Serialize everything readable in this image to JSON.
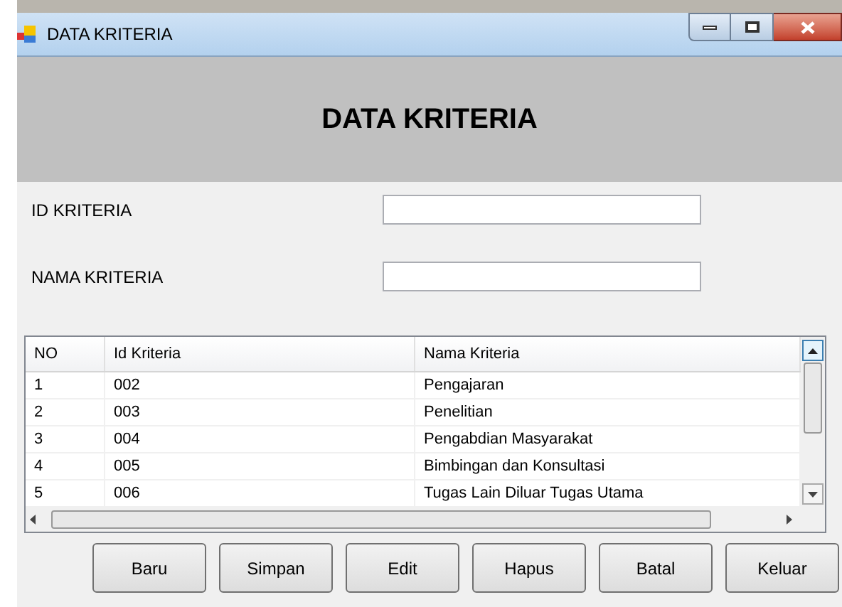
{
  "window": {
    "title": "DATA KRITERIA"
  },
  "header": {
    "title": "DATA KRITERIA"
  },
  "fields": [
    {
      "label": "ID KRITERIA"
    },
    {
      "label": "NAMA KRITERIA"
    }
  ],
  "table": {
    "columns": [
      "NO",
      "Id Kriteria",
      "Nama Kriteria"
    ],
    "rows": [
      [
        "1",
        "002",
        "Pengajaran"
      ],
      [
        "2",
        "003",
        "Penelitian"
      ],
      [
        "3",
        "004",
        "Pengabdian Masyarakat"
      ],
      [
        "4",
        "005",
        "Bimbingan dan Konsultasi"
      ],
      [
        "5",
        "006",
        "Tugas Lain Diluar Tugas Utama"
      ]
    ]
  },
  "buttons": [
    "Baru",
    "Simpan",
    "Edit",
    "Hapus",
    "Batal",
    "Keluar"
  ]
}
